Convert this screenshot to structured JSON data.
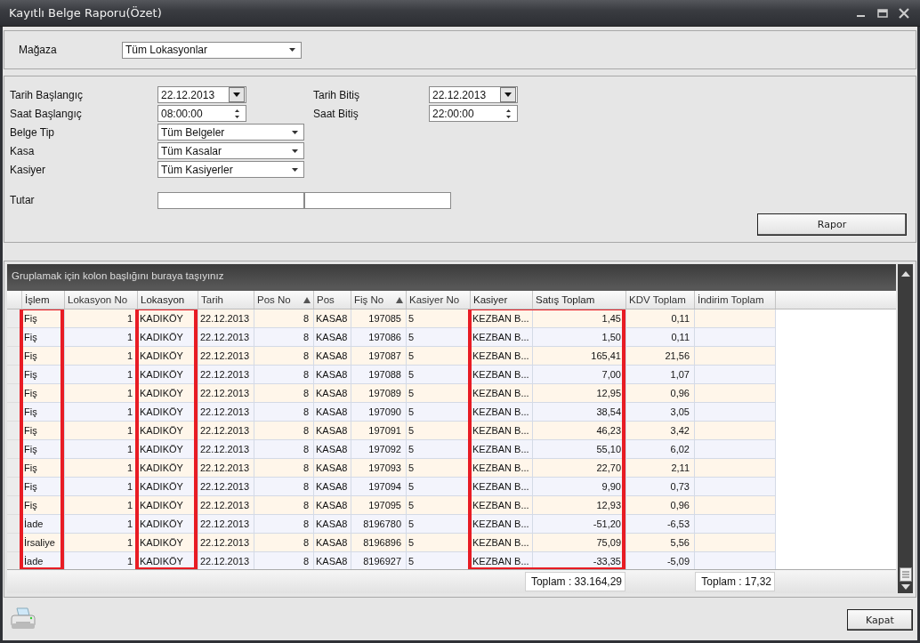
{
  "window": {
    "title": "Kayıtlı Belge Raporu(Özet)"
  },
  "store_filter": {
    "label": "Mağaza",
    "field": {
      "kind": "select",
      "value": "Tüm Lokasyonlar"
    }
  },
  "form_rows": [
    {
      "cells": [
        {
          "label": "Tarih Başlangıç",
          "fields": [
            {
              "kind": "date",
              "value": "22.12.2013"
            }
          ]
        },
        {
          "label": "Tarih Bitiş",
          "fields": [
            {
              "kind": "date",
              "value": "22.12.2013"
            }
          ]
        }
      ]
    },
    {
      "cells": [
        {
          "label": "Saat Başlangıç",
          "fields": [
            {
              "kind": "time",
              "value": "08:00:00"
            }
          ]
        },
        {
          "label": "Saat Bitiş",
          "fields": [
            {
              "kind": "time",
              "value": "22:00:00"
            }
          ]
        }
      ]
    },
    {
      "cells": [
        {
          "label": "Belge Tip",
          "fields": [
            {
              "kind": "select",
              "value": "Tüm Belgeler"
            }
          ]
        }
      ]
    },
    {
      "cells": [
        {
          "label": "Kasa",
          "fields": [
            {
              "kind": "select",
              "value": "Tüm Kasalar"
            }
          ]
        }
      ]
    },
    {
      "cells": [
        {
          "label": "Kasiyer",
          "fields": [
            {
              "kind": "select",
              "value": "Tüm Kasiyerler"
            }
          ]
        }
      ]
    },
    {
      "cells": [
        {
          "label": "Tutar",
          "fields": [
            {
              "kind": "text"
            },
            {
              "kind": "text"
            }
          ]
        }
      ]
    }
  ],
  "report_button": "Rapor",
  "grid": {
    "group_hint": "Gruplamak için kolon başlığını buraya taşıyınız",
    "columns": [
      {
        "title": "İşlem",
        "kind": "text",
        "sorted": false,
        "highlighted": true
      },
      {
        "title": "Lokasyon No",
        "kind": "number",
        "sorted": false,
        "highlighted": false
      },
      {
        "title": "Lokasyon",
        "kind": "text",
        "sorted": false,
        "highlighted": true
      },
      {
        "title": "Tarih",
        "kind": "text",
        "sorted": false,
        "highlighted": false
      },
      {
        "title": "Pos No",
        "kind": "number",
        "sorted": true,
        "highlighted": false
      },
      {
        "title": "Pos",
        "kind": "text",
        "sorted": false,
        "highlighted": false
      },
      {
        "title": "Fiş No",
        "kind": "number",
        "sorted": true,
        "highlighted": false
      },
      {
        "title": "Kasiyer No",
        "kind": "text",
        "sorted": false,
        "highlighted": false
      },
      {
        "title": "Kasiyer",
        "kind": "text",
        "sorted": false,
        "highlighted": true
      },
      {
        "title": "Satış Toplam",
        "kind": "number",
        "sorted": false,
        "highlighted": true,
        "total": "Toplam : 33.164,29"
      },
      {
        "title": "KDV Toplam",
        "kind": "number",
        "sorted": false,
        "highlighted": false
      },
      {
        "title": "İndirim Toplam",
        "kind": "number",
        "sorted": false,
        "highlighted": false,
        "total": "Toplam : 17,32"
      }
    ],
    "rows": [
      [
        "Fiş",
        "1",
        "KADIKÖY",
        "22.12.2013",
        "8",
        "KASA8",
        "197085",
        "5",
        "KEZBAN B...",
        "1,45",
        "0,11"
      ],
      [
        "Fiş",
        "1",
        "KADIKÖY",
        "22.12.2013",
        "8",
        "KASA8",
        "197086",
        "5",
        "KEZBAN B...",
        "1,50",
        "0,11"
      ],
      [
        "Fiş",
        "1",
        "KADIKÖY",
        "22.12.2013",
        "8",
        "KASA8",
        "197087",
        "5",
        "KEZBAN B...",
        "165,41",
        "21,56"
      ],
      [
        "Fiş",
        "1",
        "KADIKÖY",
        "22.12.2013",
        "8",
        "KASA8",
        "197088",
        "5",
        "KEZBAN B...",
        "7,00",
        "1,07"
      ],
      [
        "Fiş",
        "1",
        "KADIKÖY",
        "22.12.2013",
        "8",
        "KASA8",
        "197089",
        "5",
        "KEZBAN B...",
        "12,95",
        "0,96"
      ],
      [
        "Fiş",
        "1",
        "KADIKÖY",
        "22.12.2013",
        "8",
        "KASA8",
        "197090",
        "5",
        "KEZBAN B...",
        "38,54",
        "3,05"
      ],
      [
        "Fiş",
        "1",
        "KADIKÖY",
        "22.12.2013",
        "8",
        "KASA8",
        "197091",
        "5",
        "KEZBAN B...",
        "46,23",
        "3,42"
      ],
      [
        "Fiş",
        "1",
        "KADIKÖY",
        "22.12.2013",
        "8",
        "KASA8",
        "197092",
        "5",
        "KEZBAN B...",
        "55,10",
        "6,02"
      ],
      [
        "Fiş",
        "1",
        "KADIKÖY",
        "22.12.2013",
        "8",
        "KASA8",
        "197093",
        "5",
        "KEZBAN B...",
        "22,70",
        "2,11"
      ],
      [
        "Fiş",
        "1",
        "KADIKÖY",
        "22.12.2013",
        "8",
        "KASA8",
        "197094",
        "5",
        "KEZBAN B...",
        "9,90",
        "0,73"
      ],
      [
        "Fiş",
        "1",
        "KADIKÖY",
        "22.12.2013",
        "8",
        "KASA8",
        "197095",
        "5",
        "KEZBAN B...",
        "12,93",
        "0,96"
      ],
      [
        "İade",
        "1",
        "KADIKÖY",
        "22.12.2013",
        "8",
        "KASA8",
        "8196780",
        "5",
        "KEZBAN B...",
        "-51,20",
        "-6,53"
      ],
      [
        "İrsaliye",
        "1",
        "KADIKÖY",
        "22.12.2013",
        "8",
        "KASA8",
        "8196896",
        "5",
        "KEZBAN B...",
        "75,09",
        "5,56"
      ],
      [
        "İade",
        "1",
        "KADIKÖY",
        "22.12.2013",
        "8",
        "KASA8",
        "8196927",
        "5",
        "KEZBAN B...",
        "-33,35",
        "-5,09"
      ]
    ]
  },
  "close_button": "Kapat"
}
